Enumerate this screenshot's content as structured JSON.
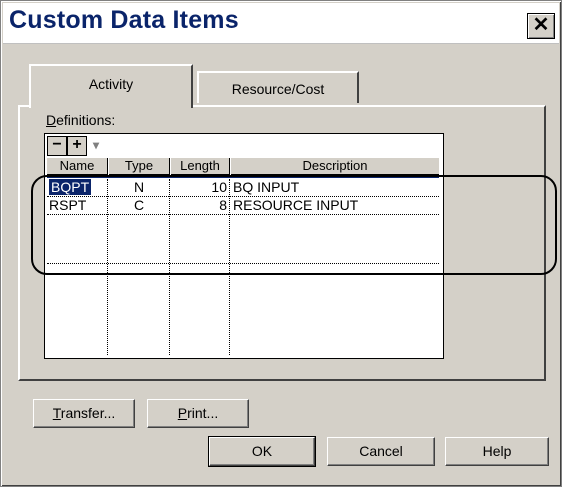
{
  "window": {
    "title": "Custom Data Items",
    "close_glyph": "✕"
  },
  "tabs": [
    {
      "label": "Activity",
      "active": true
    },
    {
      "label": "Resource/Cost",
      "active": false
    }
  ],
  "definitions": {
    "label_prefix": "D",
    "label_rest": "efinitions:",
    "toolbar": {
      "remove": "−",
      "add": "+",
      "dropdown": "▾"
    },
    "columns": [
      "Name",
      "Type",
      "Length",
      "Description"
    ],
    "rows": [
      {
        "name": "BQPT",
        "type": "N",
        "length": "10",
        "description": "BQ INPUT"
      },
      {
        "name": "RSPT",
        "type": "C",
        "length": "8",
        "description": "RESOURCE INPUT"
      }
    ]
  },
  "buttons": {
    "transfer_prefix": "T",
    "transfer_rest": "ransfer...",
    "print_prefix": "P",
    "print_rest": "rint...",
    "ok": "OK",
    "cancel": "Cancel",
    "help": "Help"
  },
  "colors": {
    "title": "#0a246a",
    "dialog_bg": "#d4d0c8",
    "selection": "#0a246a"
  }
}
